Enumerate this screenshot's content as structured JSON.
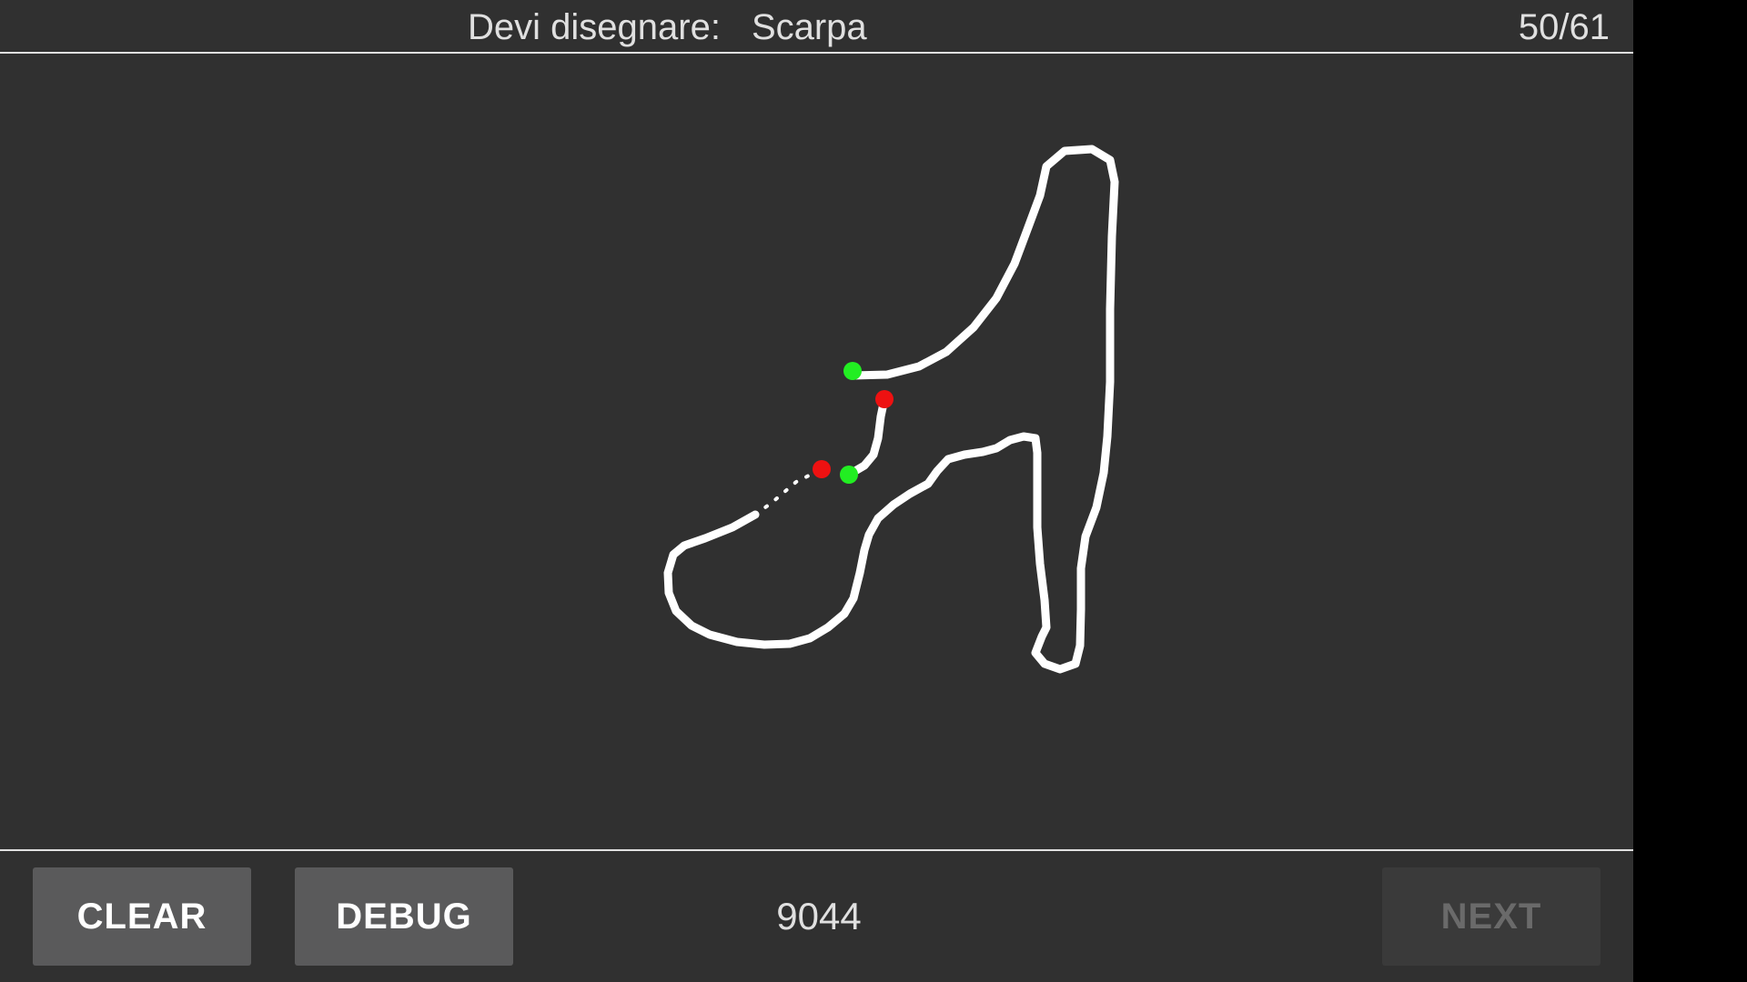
{
  "header": {
    "prompt_label": "Devi disegnare:",
    "target_word": "Scarpa",
    "progress": "50/61"
  },
  "drawing": {
    "stroke_color": "#ffffff",
    "start_marker_color": "#22ee22",
    "end_marker_color": "#ee1111",
    "stroke_count": 3
  },
  "footer": {
    "clear_label": "CLEAR",
    "debug_label": "DEBUG",
    "score": "9044",
    "next_label": "NEXT"
  },
  "colors": {
    "background": "#303030",
    "rule": "#e0e0e0",
    "button": "#5a5a5b",
    "button_disabled": "#3a3a3a"
  }
}
